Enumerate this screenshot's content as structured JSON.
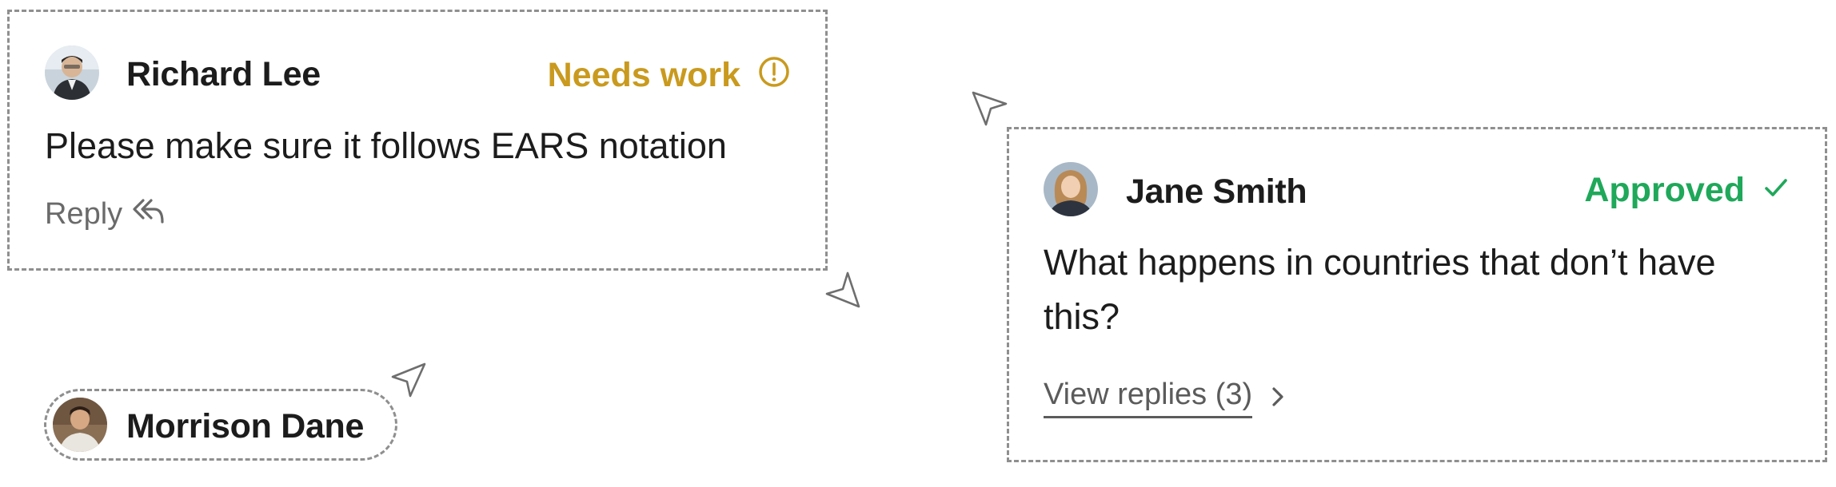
{
  "comments": [
    {
      "author": "Richard Lee",
      "status": "Needs work",
      "status_color": "#C99A1E",
      "status_icon": "alert-circle-icon",
      "body": "Please make sure it follows EARS notation",
      "action_label": "Reply",
      "action_icon": "reply-icon"
    },
    {
      "author": "Jane Smith",
      "status": "Approved",
      "status_color": "#1FA85A",
      "status_icon": "check-icon",
      "body": "What happens in countries that don’t have this?",
      "action_label": "View replies (3)",
      "action_icon": "chevron-right-icon"
    }
  ],
  "collaborator_chip": {
    "name": "Morrison Dane"
  },
  "cursor_icon": "pointer-arrow-icon"
}
